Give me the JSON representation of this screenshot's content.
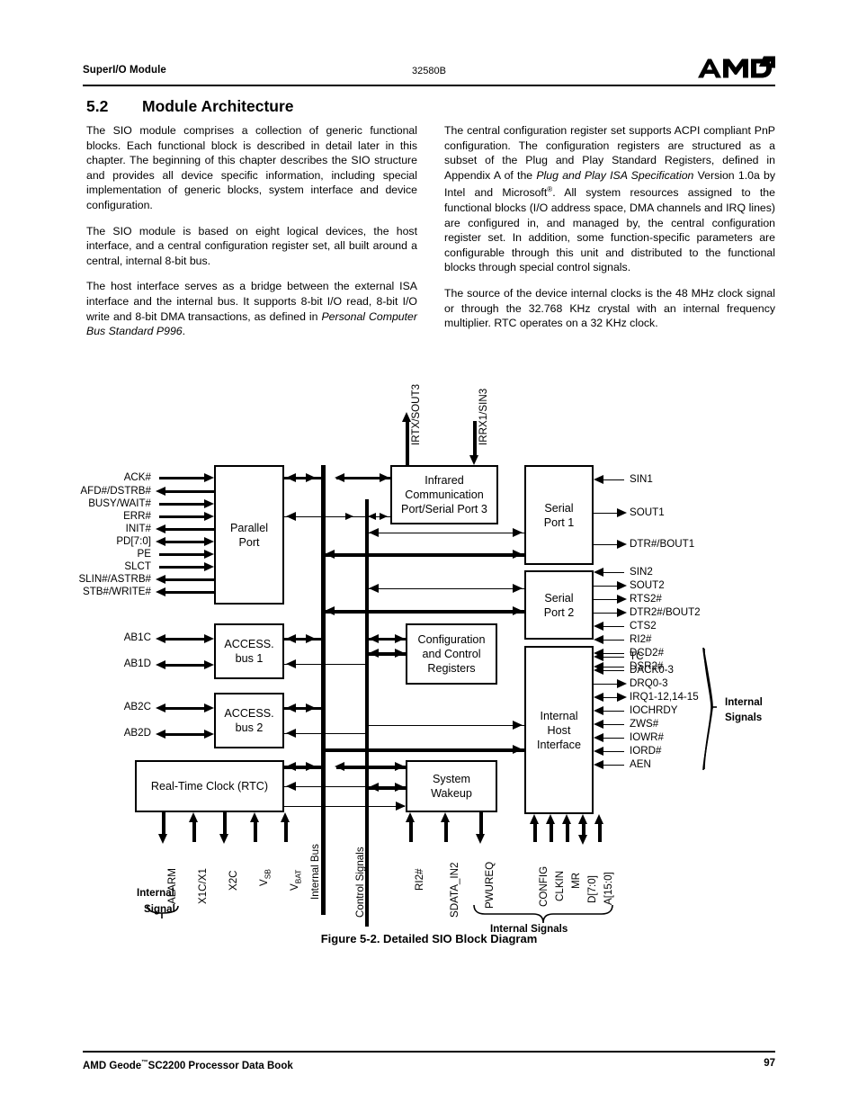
{
  "header": {
    "left_title": "SuperI/O Module",
    "doc_number": "32580B",
    "logo": "AMD"
  },
  "section": {
    "number": "5.2",
    "title": "Module Architecture"
  },
  "body": {
    "left_column": [
      "The SIO module comprises a collection of generic functional blocks. Each functional block is described in detail later in this chapter. The beginning of this chapter describes the SIO structure and provides all device specific information, including special implementation of generic blocks, system interface and device configuration.",
      "The SIO module is based on eight logical devices, the host interface, and a central configuration register set, all built around a central, internal 8-bit bus.",
      "The host interface serves as a bridge between the external ISA interface and the internal bus. It supports 8-bit I/O read, 8-bit I/O write and 8-bit DMA transactions, as defined in "
    ],
    "left_column_italic_tail": "Personal Computer Bus Standard P996",
    "left_column_tail_end": ".",
    "right_column": {
      "para1_a": "The central configuration register set supports ACPI compliant PnP configuration. The configuration registers are structured as a subset of the Plug and Play Standard Registers, defined in Appendix A of the ",
      "para1_italic1": "Plug and Play ISA Specification",
      "para1_b": " Version 1.0a by Intel and Microsoft",
      "para1_sup": "®",
      "para1_c": ". All system resources assigned to the functional blocks (I/O address space, DMA channels and IRQ lines) are configured in, and managed by, the central configuration register set. In addition, some function-specific parameters are configurable through this unit and distributed to the functional blocks through special control signals.",
      "para2": "The source of the device internal clocks is the 48 MHz clock signal or through the 32.768 KHz crystal with an internal frequency multiplier. RTC operates on a 32 KHz clock."
    }
  },
  "figure": {
    "caption": "Figure 5-2.  Detailed SIO Block Diagram",
    "blocks": {
      "parallel_port": "Parallel\nPort",
      "parallel_port_line1": "Parallel",
      "parallel_port_line2": "Port",
      "infrared": "Infrared\nCommunication\nPort/Serial Port 3",
      "infrared_line1": "Infrared",
      "infrared_line2": "Communication",
      "infrared_line3": "Port/Serial Port 3",
      "serial1_line1": "Serial",
      "serial1_line2": "Port 1",
      "serial2_line1": "Serial",
      "serial2_line2": "Port 2",
      "accessbus1_line1": "ACCESS.",
      "accessbus1_line2": "bus 1",
      "accessbus2_line1": "ACCESS.",
      "accessbus2_line2": "bus 2",
      "config_line1": "Configuration",
      "config_line2": "and Control",
      "config_line3": "Registers",
      "rtc": "Real-Time Clock (RTC)",
      "wakeup_line1": "System",
      "wakeup_line2": "Wakeup",
      "host_line1": "Internal",
      "host_line2": "Host",
      "host_line3": "Interface"
    },
    "parallel_port_signals": [
      "ACK#",
      "AFD#/DSTRB#",
      "BUSY/WAIT#",
      "ERR#",
      "INIT#",
      "PD[7:0]",
      "PE",
      "SLCT",
      "SLIN#/ASTRB#",
      "STB#/WRITE#"
    ],
    "accessbus_signals": [
      "AB1C",
      "AB1D",
      "AB2C",
      "AB2D"
    ],
    "serial1_signals": [
      "SIN1",
      "SOUT1",
      "DTR#/BOUT1"
    ],
    "serial2_signals": [
      "SIN2",
      "SOUT2",
      "RTS2#",
      "DTR2#/BOUT2",
      "CTS2",
      "RI2#",
      "DCD2#",
      "DSR2#"
    ],
    "host_signals": [
      "TC",
      "DACK0-3",
      "DRQ0-3",
      "IRQ1-12,14-15",
      "IOCHRDY",
      "ZWS#",
      "IOWR#",
      "IORD#",
      "AEN"
    ],
    "host_signals_brace_label_line1": "Internal",
    "host_signals_brace_label_line2": "Signals",
    "ir_top_signals": [
      "IRTX/SOUT3",
      "IRRX1/SIN3"
    ],
    "rtc_bottom_signals": [
      "ALARM",
      "X1C/X1",
      "X2C",
      "VSB",
      "VBAT"
    ],
    "rtc_bottom_signals_sub": [
      "",
      "",
      "",
      "SB",
      "BAT"
    ],
    "rtc_bottom_signals_base": [
      "ALARM",
      "X1C/X1",
      "X2C",
      "V",
      "V"
    ],
    "rtc_brace_label_line1": "Internal",
    "rtc_brace_label_line2": "Signal",
    "bus_labels": [
      "Internal Bus",
      "Control Signals"
    ],
    "wakeup_bottom_signals": [
      "RI2#",
      "SDATA_IN2",
      "PWUREQ"
    ],
    "host_bottom_signals": [
      "CONFIG",
      "CLKIN",
      "MR",
      "D[7:0]",
      "A[15:0]"
    ],
    "bottom_brace_label": "Internal Signals"
  },
  "footer": {
    "left": "AMD Geode",
    "left_tm": "™",
    "left_cont": "SC2200  Processor Data Book",
    "page": "97"
  }
}
